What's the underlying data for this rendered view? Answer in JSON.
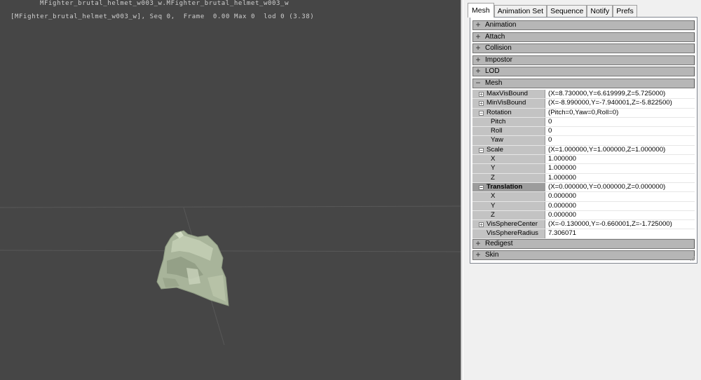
{
  "viewport": {
    "overlay_line1": "MFighter_brutal_helmet_w003_w.MFighter_brutal_helmet_w003_w",
    "overlay_line2": "[MFighter_brutal_helmet_w003_w], Seq 0,  Frame  0.00 Max 0  lod 0 (3.38)",
    "background_color": "#464646",
    "mesh_color": "#a8b49a"
  },
  "tabs": [
    {
      "label": "Mesh",
      "active": true
    },
    {
      "label": "Animation Set",
      "active": false
    },
    {
      "label": "Sequence",
      "active": false
    },
    {
      "label": "Notify",
      "active": false
    },
    {
      "label": "Prefs",
      "active": false
    }
  ],
  "categories": {
    "animation": "Animation",
    "attach": "Attach",
    "collision": "Collision",
    "impostor": "Impostor",
    "lod": "LOD",
    "mesh": "Mesh",
    "redigest": "Redigest",
    "skin": "Skin"
  },
  "expand_icons": {
    "collapsed": "+",
    "expanded": "−"
  },
  "mesh_props": {
    "max_vis_bound": {
      "name": "MaxVisBound",
      "value": "(X=8.730000,Y=6.619999,Z=5.725000)"
    },
    "min_vis_bound": {
      "name": "MinVisBound",
      "value": "(X=-8.990000,Y=-7.940001,Z=-5.822500)"
    },
    "rotation": {
      "name": "Rotation",
      "value": "(Pitch=0,Yaw=0,Roll=0)",
      "pitch": {
        "name": "Pitch",
        "value": "0"
      },
      "roll": {
        "name": "Roll",
        "value": "0"
      },
      "yaw": {
        "name": "Yaw",
        "value": "0"
      }
    },
    "scale": {
      "name": "Scale",
      "value": "(X=1.000000,Y=1.000000,Z=1.000000)",
      "x": {
        "name": "X",
        "value": "1.000000"
      },
      "y": {
        "name": "Y",
        "value": "1.000000"
      },
      "z": {
        "name": "Z",
        "value": "1.000000"
      }
    },
    "translation": {
      "name": "Translation",
      "value": "(X=0.000000,Y=0.000000,Z=0.000000)",
      "x": {
        "name": "X",
        "value": "0.000000"
      },
      "y": {
        "name": "Y",
        "value": "0.000000"
      },
      "z": {
        "name": "Z",
        "value": "0.000000"
      }
    },
    "vis_sphere_center": {
      "name": "VisSphereCenter",
      "value": "(X=-0.130000,Y=-0.660001,Z=-1.725000)"
    },
    "vis_sphere_radius": {
      "name": "VisSphereRadius",
      "value": "7.306071"
    }
  }
}
